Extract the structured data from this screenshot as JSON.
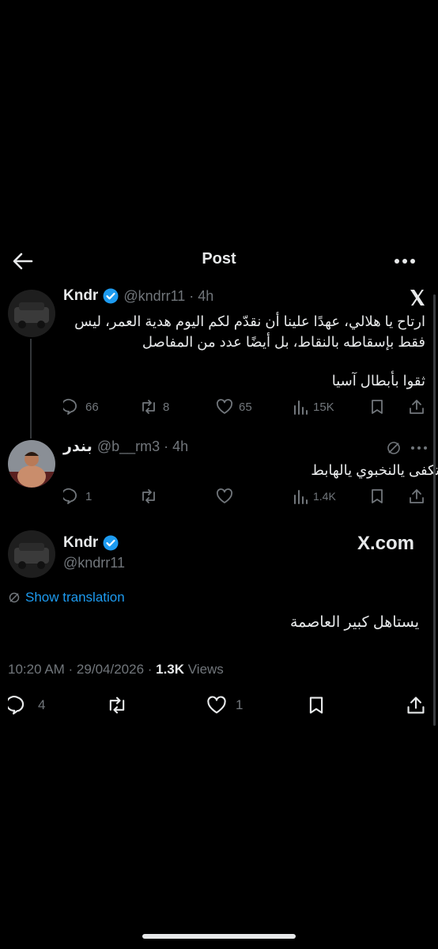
{
  "header": {
    "title": "Post",
    "back_icon": "arrow-left-icon",
    "more_icon": "more-horizontal-icon"
  },
  "quoted_post": {
    "name": "Kndr",
    "handle_time": "@kndrr11 · 4h",
    "text_line1": "ارتاح يا هلالي، عهدًا علينا أن نقدّم لكم اليوم هدية العمر، ليس",
    "text_line2": "فقط بإسقاطه بالنقاط، بل أيضًا عدد من المفاصل",
    "text_line3": "ثقوا بأبطال آسيا",
    "stats": {
      "replies": "66",
      "reposts": "8",
      "likes": "65",
      "views": "15K"
    }
  },
  "reply_post": {
    "name": "بندر",
    "handle_time": "@b__rm3 · 4h",
    "text": "تكفى يالنخبوي يالهابط",
    "stats": {
      "replies": "1",
      "reposts": "",
      "likes": "",
      "views": "1.4K"
    }
  },
  "main_post": {
    "name": "Kndr",
    "handle": "@kndrr11",
    "brand": "X.com",
    "show_translation": "Show translation",
    "text": "يستاهل كبير العاصمة",
    "time": "10:20 AM · 29/04/2026 · ",
    "views_count": "1.3K",
    "views_label": " Views",
    "stats": {
      "replies": "4",
      "likes": "1"
    }
  },
  "colors": {
    "accent": "#1d9bf0",
    "muted": "#71767b",
    "text": "#e7e9ea",
    "background": "#000000"
  }
}
